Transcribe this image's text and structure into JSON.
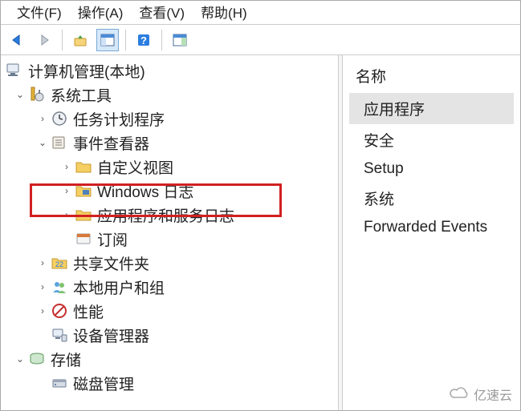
{
  "menu": {
    "file": "文件(F)",
    "action": "操作(A)",
    "view": "查看(V)",
    "help": "帮助(H)"
  },
  "tree": {
    "root": "计算机管理(本地)",
    "systemTools": "系统工具",
    "taskScheduler": "任务计划程序",
    "eventViewer": "事件查看器",
    "customViews": "自定义视图",
    "windowsLogs": "Windows 日志",
    "appServiceLogs": "应用程序和服务日志",
    "subscriptions": "订阅",
    "sharedFolders": "共享文件夹",
    "localUsers": "本地用户和组",
    "performance": "性能",
    "deviceManager": "设备管理器",
    "storage": "存储",
    "diskManagement": "磁盘管理"
  },
  "right": {
    "header": "名称",
    "items": [
      "应用程序",
      "安全",
      "Setup",
      "系统",
      "Forwarded Events"
    ]
  },
  "watermark": "亿速云"
}
